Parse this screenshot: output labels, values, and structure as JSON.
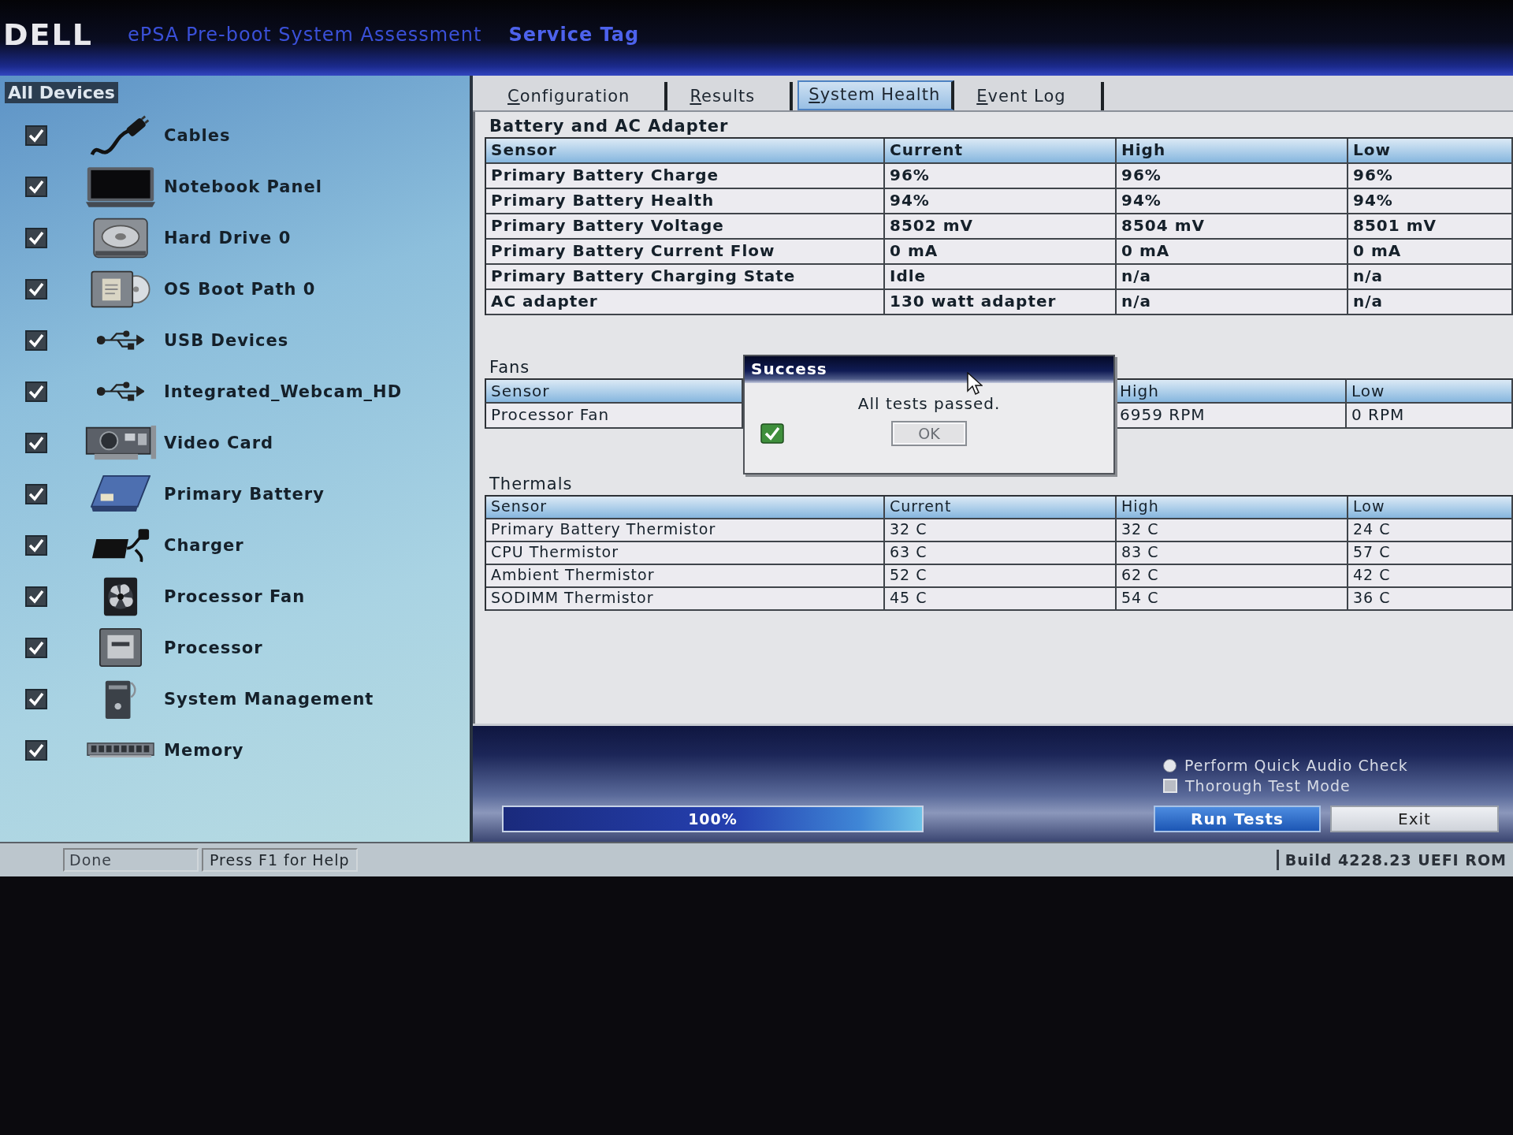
{
  "header": {
    "logo": "DELL",
    "title": "ePSA Pre-boot System Assessment",
    "service_tag_label": "Service Tag"
  },
  "sidebar": {
    "root": {
      "label": "All Devices",
      "selected": true
    },
    "items": [
      {
        "label": "Cables",
        "kind": "cable",
        "checked": true
      },
      {
        "label": "Notebook Panel",
        "kind": "panel",
        "checked": true
      },
      {
        "label": "Hard Drive 0",
        "kind": "disk",
        "checked": true
      },
      {
        "label": "OS Boot Path 0",
        "kind": "bootpath",
        "checked": true
      },
      {
        "label": "USB Devices",
        "kind": "usb",
        "checked": true
      },
      {
        "label": "Integrated_Webcam_HD",
        "kind": "usb",
        "checked": true
      },
      {
        "label": "Video Card",
        "kind": "video",
        "checked": true
      },
      {
        "label": "Primary Battery",
        "kind": "battery",
        "checked": true
      },
      {
        "label": "Charger",
        "kind": "charger",
        "checked": true
      },
      {
        "label": "Processor Fan",
        "kind": "fan",
        "checked": true
      },
      {
        "label": "Processor",
        "kind": "cpu",
        "checked": true
      },
      {
        "label": "System Management",
        "kind": "system",
        "checked": true
      },
      {
        "label": "Memory",
        "kind": "memory",
        "checked": true
      }
    ]
  },
  "tabs": [
    {
      "label": "Configuration",
      "selected": false
    },
    {
      "label": "Results",
      "selected": false
    },
    {
      "label": "System Health",
      "selected": true
    },
    {
      "label": "Event Log",
      "selected": false
    }
  ],
  "battery": {
    "title": "Battery and AC Adapter",
    "columns": [
      "Sensor",
      "Current",
      "High",
      "Low"
    ],
    "rows": [
      [
        "Primary Battery Charge",
        "96%",
        "96%",
        "96%"
      ],
      [
        "Primary Battery Health",
        "94%",
        "94%",
        "94%"
      ],
      [
        "Primary Battery Voltage",
        "8502 mV",
        "8504 mV",
        "8501 mV"
      ],
      [
        "Primary Battery Current Flow",
        "0 mA",
        "0 mA",
        "0 mA"
      ],
      [
        "Primary Battery Charging State",
        "Idle",
        "n/a",
        "n/a"
      ],
      [
        "AC adapter",
        "130 watt adapter",
        "n/a",
        "n/a"
      ]
    ]
  },
  "fans": {
    "title": "Fans",
    "columns": [
      "Sensor",
      "High",
      "Low"
    ],
    "rows": [
      [
        "Processor Fan",
        "6959 RPM",
        "0 RPM"
      ]
    ]
  },
  "thermals": {
    "title": "Thermals",
    "columns": [
      "Sensor",
      "Current",
      "High",
      "Low"
    ],
    "rows": [
      [
        "Primary Battery Thermistor",
        "32 C",
        "32 C",
        "24 C"
      ],
      [
        "CPU Thermistor",
        "63 C",
        "83 C",
        "57 C"
      ],
      [
        "Ambient Thermistor",
        "52 C",
        "62 C",
        "42 C"
      ],
      [
        "SODIMM Thermistor",
        "45 C",
        "54 C",
        "36 C"
      ]
    ]
  },
  "dialog": {
    "title": "Success",
    "message": "All tests passed.",
    "button": "OK"
  },
  "progress": {
    "level": 1,
    "label": "100%"
  },
  "options": [
    {
      "kind": "radio",
      "label": "Perform Quick Audio Check",
      "checked": false
    },
    {
      "kind": "checkbox",
      "label": "Thorough Test Mode",
      "checked": false
    }
  ],
  "buttons": [
    {
      "label": "Run Tests",
      "kind": "primary"
    },
    {
      "label": "Exit",
      "kind": "secondary"
    }
  ],
  "status_bar": {
    "status": "Done",
    "hint": "Press F1 for Help",
    "build": "Build 4228.23 UEFI ROM"
  }
}
